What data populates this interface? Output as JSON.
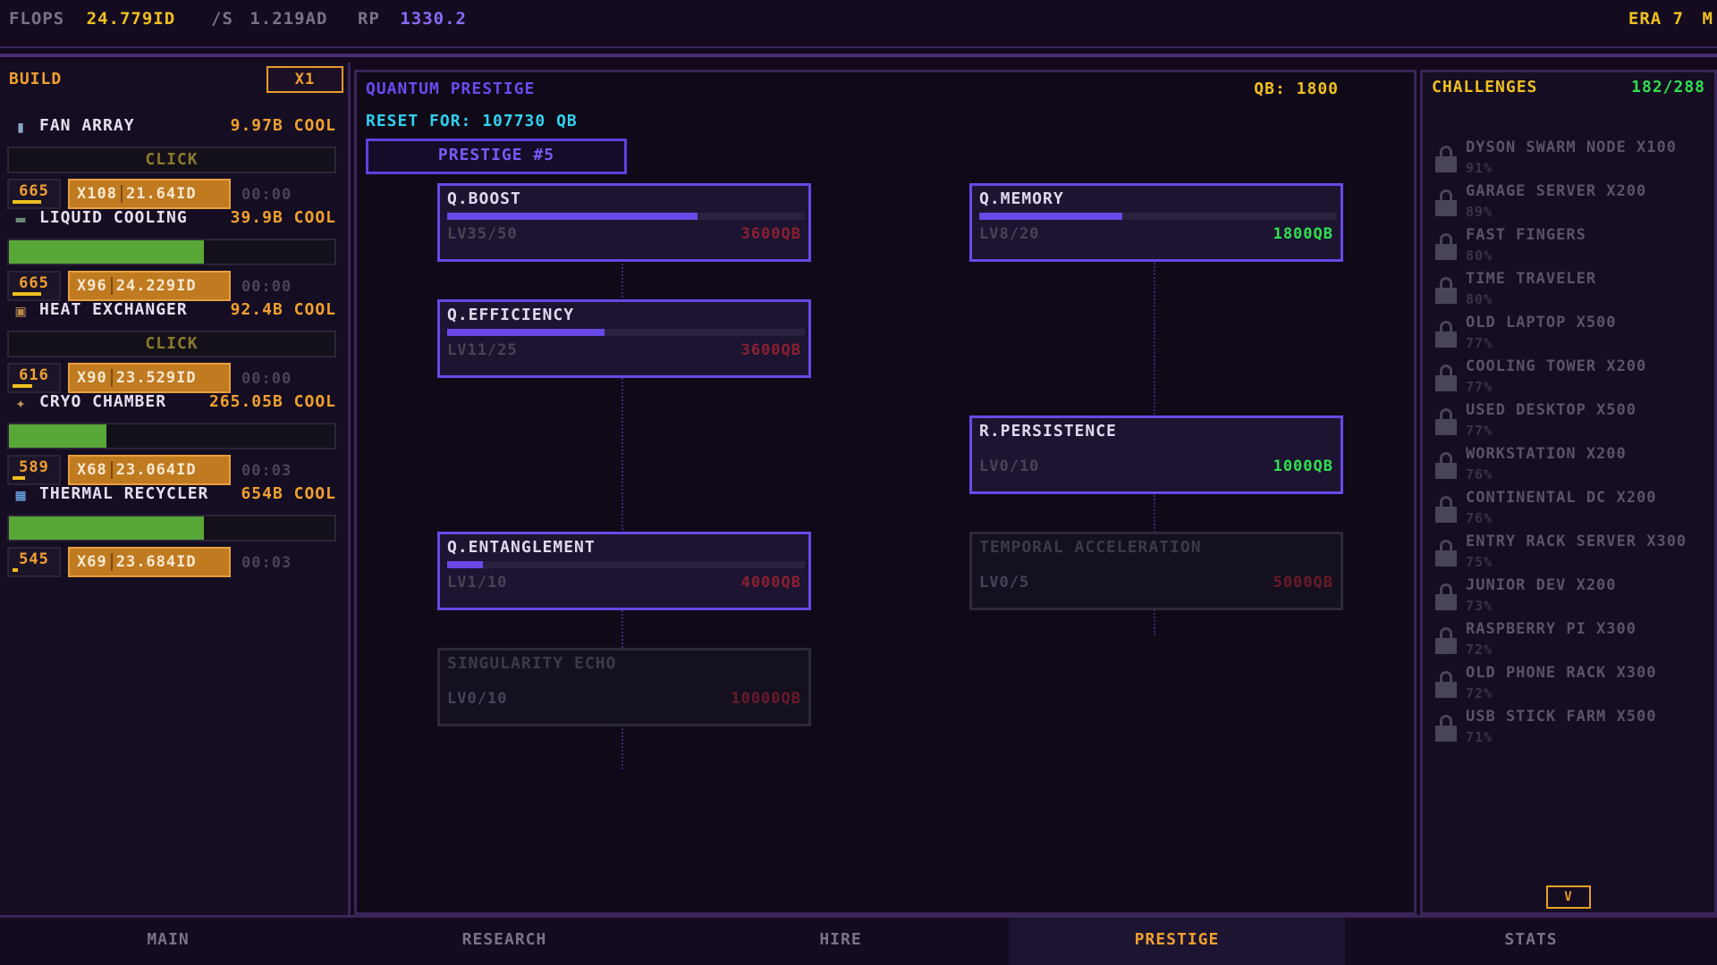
{
  "topbar": {
    "flops_label": "FLOPS",
    "flops_value": "24.779ID",
    "rate_label": "/S",
    "rate_value": "1.219AD",
    "rp_label": "RP",
    "rp_value": "1330.2",
    "era_label": "ERA 7",
    "era_suffix": "M"
  },
  "build": {
    "header": "BUILD",
    "multiplier": "X1",
    "items": [
      {
        "name": "FAN ARRAY",
        "cool": "9.97B COOL",
        "action": "CLICK",
        "count": "665",
        "buy_mult": "X108",
        "buy_cost": "21.64ID",
        "timer": "00:00",
        "icon": "fan-icon",
        "progress": 0,
        "count_fill": 0.8
      },
      {
        "name": "LIQUID COOLING",
        "cool": "39.9B COOL",
        "action": "",
        "count": "665",
        "buy_mult": "X96",
        "buy_cost": "24.229ID",
        "timer": "00:00",
        "icon": "liquid-icon",
        "progress": 0.6,
        "count_fill": 0.8
      },
      {
        "name": "HEAT EXCHANGER",
        "cool": "92.4B COOL",
        "action": "CLICK",
        "count": "616",
        "buy_mult": "X90",
        "buy_cost": "23.529ID",
        "timer": "00:00",
        "icon": "exchanger-icon",
        "progress": 0,
        "count_fill": 0.55
      },
      {
        "name": "CRYO CHAMBER",
        "cool": "265.05B COOL",
        "action": "",
        "count": "589",
        "buy_mult": "X68",
        "buy_cost": "23.064ID",
        "timer": "00:03",
        "icon": "cryo-icon",
        "progress": 0.3,
        "count_fill": 0.35
      },
      {
        "name": "THERMAL RECYCLER",
        "cool": "654B COOL",
        "action": "",
        "count": "545",
        "buy_mult": "X69",
        "buy_cost": "23.684ID",
        "timer": "00:03",
        "icon": "grid-icon",
        "progress": 0.6,
        "count_fill": 0.15
      }
    ]
  },
  "prestige": {
    "title": "QUANTUM PRESTIGE",
    "qb": "QB: 1800",
    "reset": "RESET FOR: 107730 QB",
    "button": "PRESTIGE #5",
    "nodes": [
      {
        "name": "Q.BOOST",
        "level": "LV35/50",
        "cost": "3600QB",
        "state": "unaffordable",
        "progress": 0.7
      },
      {
        "name": "Q.MEMORY",
        "level": "LV8/20",
        "cost": "1800QB",
        "state": "affordable",
        "progress": 0.4
      },
      {
        "name": "Q.EFFICIENCY",
        "level": "LV11/25",
        "cost": "3600QB",
        "state": "unaffordable",
        "progress": 0.44
      },
      {
        "name": "R.PERSISTENCE",
        "level": "LV0/10",
        "cost": "1000QB",
        "state": "affordable",
        "progress": 0
      },
      {
        "name": "Q.ENTANGLEMENT",
        "level": "LV1/10",
        "cost": "4000QB",
        "state": "unaffordable",
        "progress": 0.1
      },
      {
        "name": "TEMPORAL ACCELERATION",
        "level": "LV0/5",
        "cost": "5000QB",
        "state": "locked",
        "progress": 0
      },
      {
        "name": "SINGULARITY ECHO",
        "level": "LV0/10",
        "cost": "10000QB",
        "state": "locked",
        "progress": 0
      }
    ]
  },
  "challenges": {
    "header": "CHALLENGES",
    "count": "182/288",
    "items": [
      {
        "name": "DYSON SWARM NODE X100",
        "pct": "91%"
      },
      {
        "name": "GARAGE SERVER X200",
        "pct": "89%"
      },
      {
        "name": "FAST FINGERS",
        "pct": "80%"
      },
      {
        "name": "TIME TRAVELER",
        "pct": "80%"
      },
      {
        "name": "OLD LAPTOP X500",
        "pct": "77%"
      },
      {
        "name": "COOLING TOWER X200",
        "pct": "77%"
      },
      {
        "name": "USED DESKTOP X500",
        "pct": "77%"
      },
      {
        "name": "WORKSTATION X200",
        "pct": "76%"
      },
      {
        "name": "CONTINENTAL DC X200",
        "pct": "76%"
      },
      {
        "name": "ENTRY RACK SERVER X300",
        "pct": "75%"
      },
      {
        "name": "JUNIOR DEV X200",
        "pct": "73%"
      },
      {
        "name": "RASPBERRY PI X300",
        "pct": "72%"
      },
      {
        "name": "OLD PHONE RACK X300",
        "pct": "72%"
      },
      {
        "name": "USB STICK FARM X500",
        "pct": "71%"
      }
    ],
    "scroll_label": "V"
  },
  "nav": {
    "tabs": [
      "MAIN",
      "RESEARCH",
      "HIRE",
      "PRESTIGE",
      "STATS"
    ],
    "active": "PRESTIGE"
  },
  "colors": {
    "accent_orange": "#f0a030",
    "accent_purple": "#6a48e8",
    "accent_green": "#30e050",
    "accent_cyan": "#30d0f0",
    "accent_yellow": "#f0c020"
  }
}
